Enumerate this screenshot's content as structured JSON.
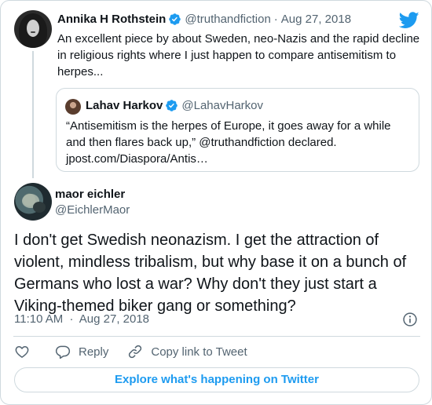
{
  "parent_tweet": {
    "name": "Annika H Rothstein",
    "handle": "@truthandfiction",
    "date": "Aug 27, 2018",
    "separator": "·",
    "text": "An excellent piece by about Sweden, neo-Nazis and the rapid decline in religious rights where I just happen to compare antisemitism to herpes..."
  },
  "quoted_tweet": {
    "name": "Lahav Harkov",
    "handle": "@LahavHarkov",
    "text": "“Antisemitism is the herpes of Europe, it goes away for a while and then flares back up,” @truthandfiction declared. jpost.com/Diaspora/Antis…"
  },
  "main_tweet": {
    "name": "maor eichler",
    "handle": "@EichlerMaor",
    "text": "I don't get Swedish neonazism. I get the attraction of violent, mindless tribalism, but why base it on a bunch of Germans who lost a war? Why don't they just start a Viking-themed biker gang or something?",
    "time": "11:10 AM",
    "separator": "·",
    "date": "Aug 27, 2018"
  },
  "actions": {
    "reply_label": "Reply",
    "copy_link_label": "Copy link to Tweet"
  },
  "footer": {
    "explore_label": "Explore what's happening on Twitter"
  },
  "icons": {
    "verified": "verified-badge-icon",
    "brand": "twitter-bird-icon",
    "info": "info-icon",
    "like": "heart-icon",
    "reply": "speech-bubble-icon",
    "copy_link": "link-icon"
  },
  "colors": {
    "accent": "#1d9bf0",
    "muted_text": "#536471",
    "border": "#cfd9de",
    "text": "#0f1419"
  }
}
